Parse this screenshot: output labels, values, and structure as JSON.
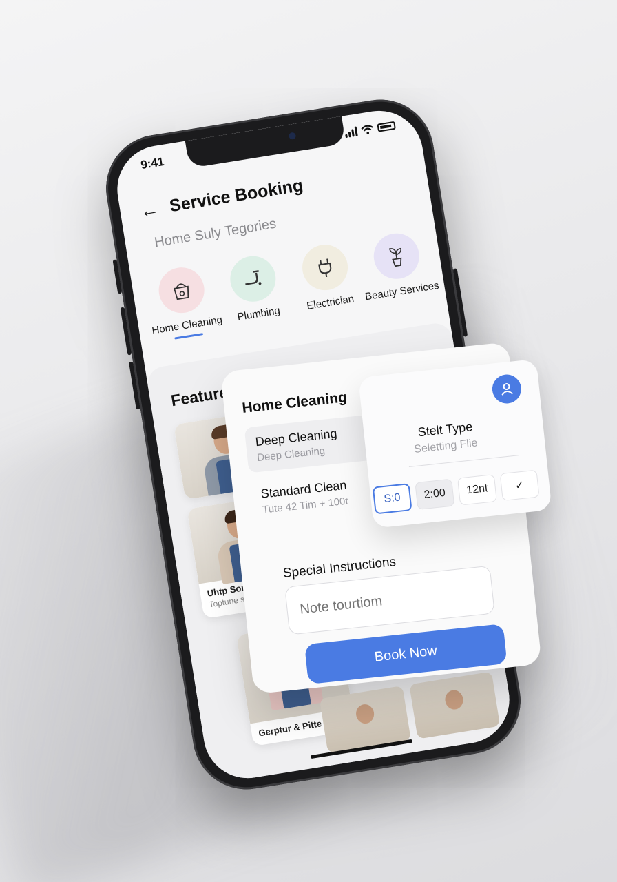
{
  "status": {
    "time": "9:41"
  },
  "header": {
    "title": "Service Booking"
  },
  "subtitle": "Home Suly Tegories",
  "categories": [
    {
      "label": "Home Cleaning",
      "icon": "cleaning-bucket-icon",
      "color": "#f6dfe2",
      "selected": true
    },
    {
      "label": "Plumbing",
      "icon": "pipe-icon",
      "color": "#dcefe6",
      "selected": false
    },
    {
      "label": "Electrician",
      "icon": "plug-icon",
      "color": "#f1ede0",
      "selected": false
    },
    {
      "label": "Beauty Services",
      "icon": "plant-pot-icon",
      "color": "#e6e2f6",
      "selected": false
    }
  ],
  "featured": {
    "title": "Featured Services",
    "cards": [
      {
        "name": "Uhtp Son Toir",
        "desc": "Toptune sivest Dehtfuns"
      },
      {
        "name": "Gerptur & Pitte",
        "desc": ""
      }
    ]
  },
  "booking": {
    "heading": "Home Cleaning",
    "options": [
      {
        "title": "Deep Cleaning",
        "sub": "Deep Cleaning"
      },
      {
        "title": "Standard Clean",
        "sub": "Tute 42 Tim + 100t"
      }
    ],
    "special_label": "Special Instructions",
    "notes_placeholder": "Note tourtiom",
    "book_label": "Book Now"
  },
  "time_select": {
    "title": "Stelt Type",
    "subtitle": "Seletting Flie",
    "slots": [
      "S:0",
      "2:00",
      "12nt",
      "✓"
    ]
  },
  "colors": {
    "accent": "#4a7be3",
    "text": "#111111",
    "muted": "#9a9aa0"
  }
}
